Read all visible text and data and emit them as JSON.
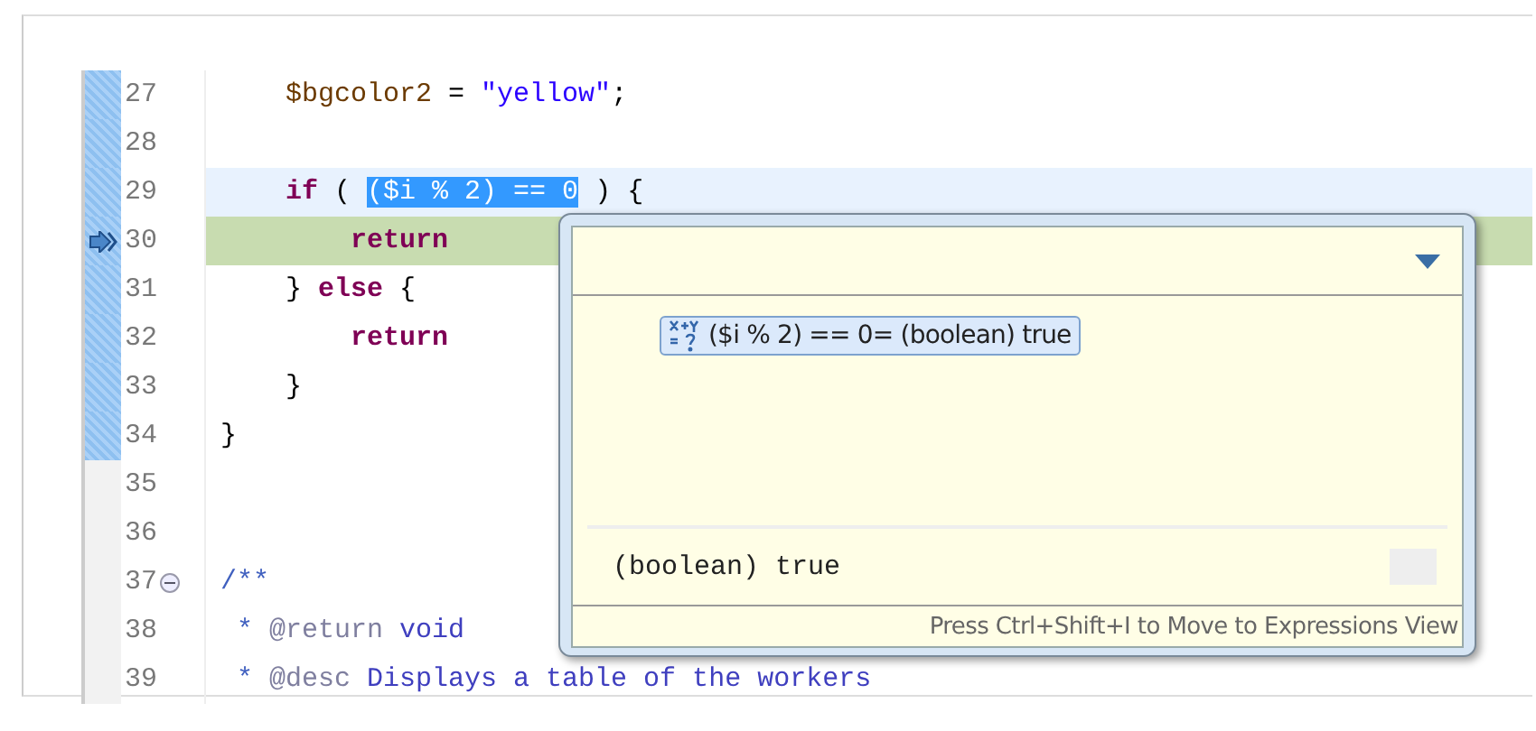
{
  "editor": {
    "lines": [
      {
        "number": "27",
        "in_range": true,
        "current_line": false,
        "executing": false,
        "foldable": false,
        "tokens": [
          {
            "kind": "var",
            "text": "    $bgcolor2"
          },
          {
            "kind": "plain",
            "text": " = "
          },
          {
            "kind": "str",
            "text": "\"yellow\""
          },
          {
            "kind": "plain",
            "text": ";"
          }
        ]
      },
      {
        "number": "28",
        "in_range": true,
        "current_line": false,
        "executing": false,
        "foldable": false
      },
      {
        "number": "29",
        "in_range": true,
        "current_line": true,
        "executing": false,
        "foldable": false,
        "tokens": [
          {
            "kind": "kw",
            "text": "    if"
          },
          {
            "kind": "plain",
            "text": " ( "
          },
          {
            "kind": "selected",
            "text": "($i % 2) == 0"
          },
          {
            "kind": "plain",
            "text": " ) {"
          }
        ]
      },
      {
        "number": "30",
        "in_range": true,
        "current_line": false,
        "executing": true,
        "foldable": false,
        "tokens": [
          {
            "kind": "kw",
            "text": "        return"
          }
        ]
      },
      {
        "number": "31",
        "in_range": true,
        "current_line": false,
        "executing": false,
        "foldable": false,
        "tokens": [
          {
            "kind": "plain",
            "text": "    } "
          },
          {
            "kind": "kw",
            "text": "else"
          },
          {
            "kind": "plain",
            "text": " {"
          }
        ]
      },
      {
        "number": "32",
        "in_range": true,
        "current_line": false,
        "executing": false,
        "foldable": false,
        "tokens": [
          {
            "kind": "kw",
            "text": "        return"
          }
        ]
      },
      {
        "number": "33",
        "in_range": true,
        "current_line": false,
        "executing": false,
        "foldable": false,
        "tokens": [
          {
            "kind": "plain",
            "text": "    }"
          }
        ]
      },
      {
        "number": "34",
        "in_range": true,
        "current_line": false,
        "executing": false,
        "foldable": false,
        "tokens": [
          {
            "kind": "plain",
            "text": "}"
          }
        ]
      },
      {
        "number": "35",
        "in_range": false,
        "current_line": false,
        "executing": false,
        "foldable": false
      },
      {
        "number": "36",
        "in_range": false,
        "current_line": false,
        "executing": false,
        "foldable": false
      },
      {
        "number": "37",
        "in_range": false,
        "current_line": false,
        "executing": false,
        "foldable": true,
        "tokens": [
          {
            "kind": "comment",
            "text": "/**"
          }
        ]
      },
      {
        "number": "38",
        "in_range": false,
        "current_line": false,
        "executing": false,
        "foldable": false,
        "tokens": [
          {
            "kind": "comment",
            "text": " * "
          },
          {
            "kind": "doctag",
            "text": "@return"
          },
          {
            "kind": "doctext",
            "text": " void"
          }
        ]
      },
      {
        "number": "39",
        "in_range": false,
        "current_line": false,
        "executing": false,
        "foldable": false,
        "tokens": [
          {
            "kind": "comment",
            "text": " * "
          },
          {
            "kind": "doctag",
            "text": "@desc"
          },
          {
            "kind": "doctext",
            "text": " Displays a table of the workers"
          }
        ]
      }
    ]
  },
  "popup": {
    "expressions": [
      {
        "label": "($i % 2) == 0= (boolean) true",
        "selected": true
      }
    ],
    "detail": "(boolean) true",
    "hint": "Press Ctrl+Shift+I to Move to Expressions View"
  }
}
